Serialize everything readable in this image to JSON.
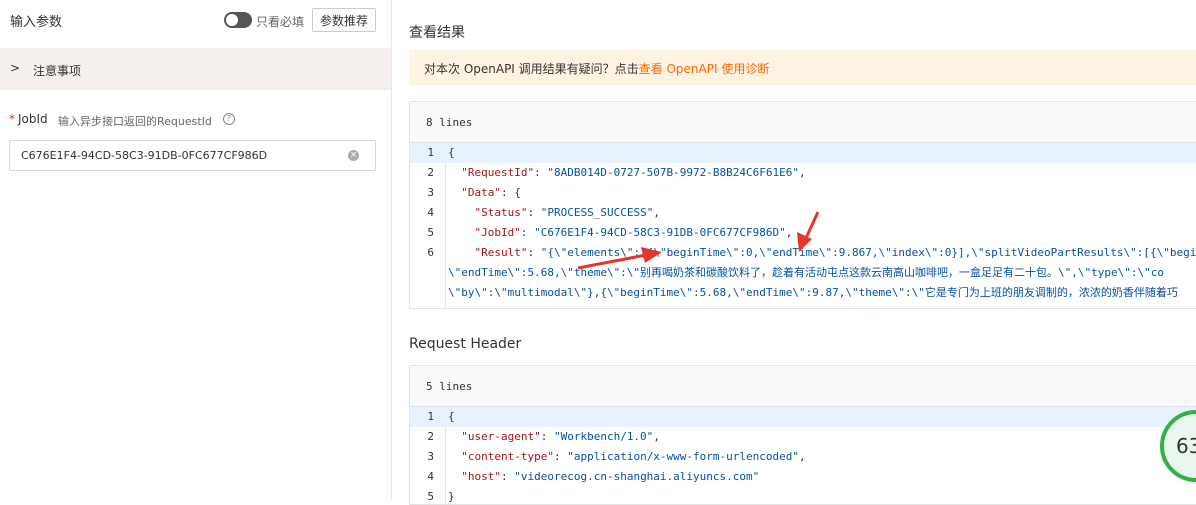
{
  "left": {
    "title": "输入参数",
    "required_only_label": "只看必填",
    "recommend_button": "参数推荐",
    "notice_label": "注意事项",
    "notice_chevron": ">",
    "jobid": {
      "required_mark": "*",
      "label": "JobId",
      "hint": "输入异步接口返回的RequestId",
      "help_glyph": "?",
      "value": "C676E1F4-94CD-58C3-91DB-0FC677CF986D"
    }
  },
  "right": {
    "result_title": "查看结果",
    "diagnose": {
      "prefix": "对本次 OpenAPI 调用结果有疑问？点击",
      "link": "查看 OpenAPI 使用诊断"
    },
    "result_panel": {
      "lines_label": "8 lines",
      "rows": [
        {
          "num": "1",
          "parts": [
            {
              "t": "{",
              "c": "p"
            }
          ]
        },
        {
          "num": "2",
          "parts": [
            {
              "t": "  \"RequestId\"",
              "c": "k"
            },
            {
              "t": ": ",
              "c": "p"
            },
            {
              "t": "\"8ADB014D-0727-507B-9972-B8B24C6F61E6\"",
              "c": "s"
            },
            {
              "t": ",",
              "c": "p"
            }
          ]
        },
        {
          "num": "3",
          "parts": [
            {
              "t": "  \"Data\"",
              "c": "k"
            },
            {
              "t": ": {",
              "c": "p"
            }
          ]
        },
        {
          "num": "4",
          "parts": [
            {
              "t": "    \"Status\"",
              "c": "k"
            },
            {
              "t": ": ",
              "c": "p"
            },
            {
              "t": "\"PROCESS_SUCCESS\"",
              "c": "s"
            },
            {
              "t": ",",
              "c": "p"
            }
          ]
        },
        {
          "num": "5",
          "parts": [
            {
              "t": "    \"JobId\"",
              "c": "k"
            },
            {
              "t": ": ",
              "c": "p"
            },
            {
              "t": "\"C676E1F4-94CD-58C3-91DB-0FC677CF986D\"",
              "c": "s"
            },
            {
              "t": ",",
              "c": "p"
            }
          ]
        },
        {
          "num": "6",
          "parts": [
            {
              "t": "    \"Result\"",
              "c": "k"
            },
            {
              "t": ": ",
              "c": "p"
            },
            {
              "t": "\"{\\\"elements\\\":[{\\\"beginTime\\\":0,\\\"endTime\\\":9.867,\\\"index\\\":0}],\\\"splitVideoPartResults\\\":[{\\\"begin",
              "c": "s"
            }
          ]
        },
        {
          "num": "",
          "parts": [
            {
              "t": "\\\"endTime\\\":5.68,\\\"theme\\\":\\\"别再喝奶茶和碳酸饮料了，趁着有活动屯点这款云南高山咖啡吧，一盒足足有二十包。\\\",\\\"type\\\":\\\"co",
              "c": "s"
            }
          ]
        },
        {
          "num": "",
          "parts": [
            {
              "t": "\\\"by\\\":\\\"multimodal\\\"},{\\\"beginTime\\\":5.68,\\\"endTime\\\":9.87,\\\"theme\\\":\\\"它是专门为上班的朋友调制的，浓浓的奶香伴随着巧",
              "c": "s"
            }
          ]
        }
      ]
    },
    "header_title": "Request Header",
    "header_panel": {
      "lines_label": "5 lines",
      "rows": [
        {
          "num": "1",
          "parts": [
            {
              "t": "{",
              "c": "p"
            }
          ]
        },
        {
          "num": "2",
          "parts": [
            {
              "t": "  \"user-agent\"",
              "c": "k"
            },
            {
              "t": ": ",
              "c": "p"
            },
            {
              "t": "\"Workbench/1.0\"",
              "c": "s"
            },
            {
              "t": ",",
              "c": "p"
            }
          ]
        },
        {
          "num": "3",
          "parts": [
            {
              "t": "  \"content-type\"",
              "c": "k"
            },
            {
              "t": ": ",
              "c": "p"
            },
            {
              "t": "\"application/x-www-form-urlencoded\"",
              "c": "s"
            },
            {
              "t": ",",
              "c": "p"
            }
          ]
        },
        {
          "num": "4",
          "parts": [
            {
              "t": "  \"host\"",
              "c": "k"
            },
            {
              "t": ": ",
              "c": "p"
            },
            {
              "t": "\"videorecog.cn-shanghai.aliyuncs.com\"",
              "c": "s"
            }
          ]
        },
        {
          "num": "5",
          "parts": [
            {
              "t": "}",
              "c": "p"
            }
          ]
        }
      ]
    },
    "score_badge": "63"
  },
  "colors": {
    "link": "#ff6a00",
    "warn_bg": "#fff4e3",
    "json_key": "#a31515",
    "json_string": "#0451a5",
    "badge_ring": "#2fb344",
    "arrow": "#e8342a"
  }
}
